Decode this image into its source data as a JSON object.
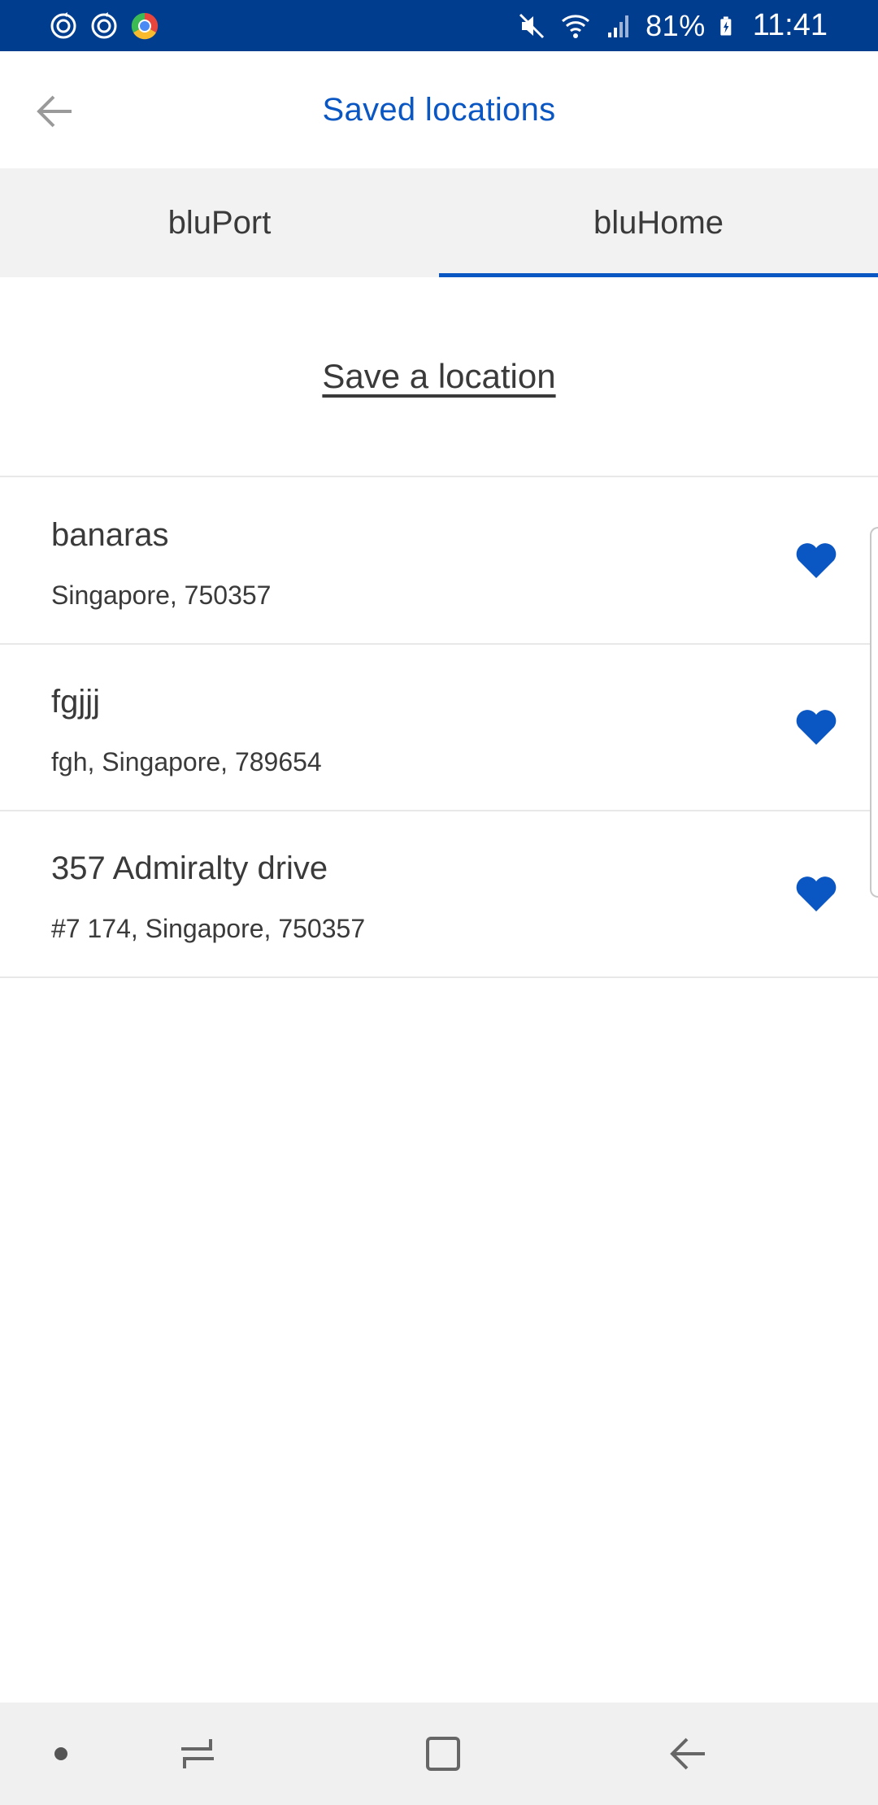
{
  "status_bar": {
    "battery_percent": "81%",
    "time": "11:41",
    "icons": [
      "sync-icon",
      "sync-icon",
      "chrome-app-icon",
      "mute-icon",
      "wifi-icon",
      "signal-icon",
      "battery-charging-icon"
    ]
  },
  "app_bar": {
    "title": "Saved locations",
    "back_icon": "arrow-left-icon"
  },
  "tabs": [
    {
      "label": "bluPort",
      "active": false
    },
    {
      "label": "bluHome",
      "active": true
    }
  ],
  "save_location_label": "Save a location",
  "locations": [
    {
      "name": "banaras",
      "address": "Singapore, 750357",
      "favorite": true
    },
    {
      "name": "fgjjj",
      "address": "fgh, Singapore, 789654",
      "favorite": true
    },
    {
      "name": "357 Admiralty drive",
      "address": "#7 174, Singapore, 750357",
      "favorite": true
    }
  ],
  "nav_bar": {
    "icons": [
      "dot-icon",
      "recent-apps-icon",
      "home-icon",
      "back-icon"
    ]
  },
  "colors": {
    "status_bar": "#003d8f",
    "accent": "#0a56c2",
    "text": "#3a3a3a",
    "tab_background": "#f2f2f2",
    "nav_background": "#f0f0f0"
  }
}
